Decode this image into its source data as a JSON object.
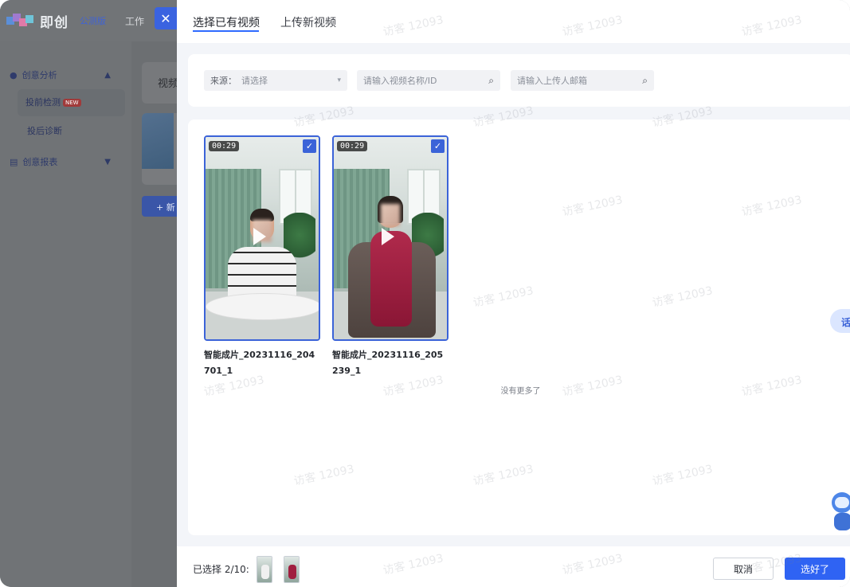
{
  "app": {
    "name": "即创",
    "badge": "公测版",
    "workspace_partial": "工作",
    "sidebar": {
      "group1": "创意分析",
      "item1": "投前检测",
      "item1_badge": "NEW",
      "item2": "投后诊断",
      "group2": "创意报表"
    },
    "main": {
      "card_title_partial": "视频",
      "new_button_partial": "+ 新"
    }
  },
  "drawer": {
    "close": "✕",
    "tabs": [
      {
        "label": "选择已有视频",
        "active": true
      },
      {
        "label": "上传新视频",
        "active": false
      }
    ],
    "filters": {
      "source_label": "来源：",
      "source_placeholder": "请选择",
      "name_placeholder": "请输入视频名称/ID",
      "email_placeholder": "请输入上传人邮箱"
    },
    "videos": [
      {
        "duration": "00:29",
        "name": "智能成片_20231116_204701_1",
        "selected": true
      },
      {
        "duration": "00:29",
        "name": "智能成片_20231116_205239_1",
        "selected": true
      }
    ],
    "no_more": "没有更多了",
    "footer": {
      "selected": "已选择 2/10:",
      "cancel": "取消",
      "confirm": "选好了"
    },
    "float_button": "话"
  },
  "watermark": "访客 12093",
  "colors": {
    "primary": "#2f63f3",
    "selected_border": "#3b63d8",
    "overlay": "#6f7275"
  }
}
